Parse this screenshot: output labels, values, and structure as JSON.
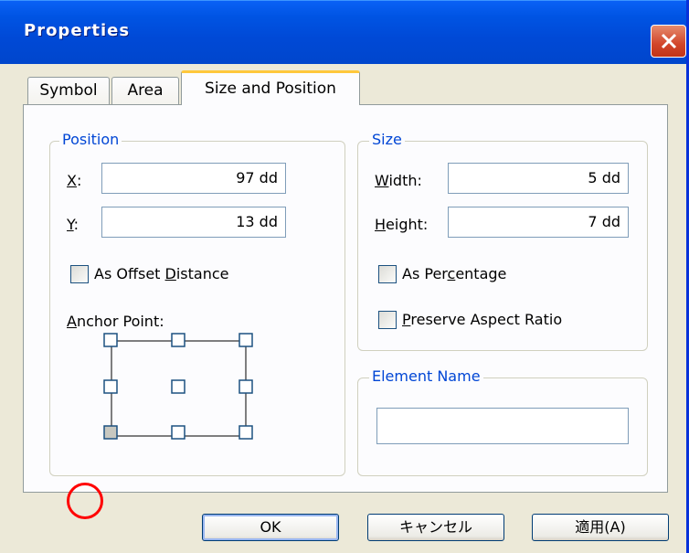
{
  "window": {
    "title": "Properties"
  },
  "tabs": [
    {
      "label": "Symbol"
    },
    {
      "label": "Area"
    },
    {
      "label": "Size and Position"
    }
  ],
  "position": {
    "group_label": "Position",
    "x_label_key": "X",
    "x_label_rest": ":",
    "x_value": "97 dd",
    "y_label_key": "Y",
    "y_label_rest": ":",
    "y_value": "13 dd",
    "offset_pre": "As Offset ",
    "offset_key": "D",
    "offset_post": "istance",
    "offset_checked": false,
    "anchor_key": "A",
    "anchor_rest": "nchor Point:",
    "anchor_selected": "bottom-left"
  },
  "size": {
    "group_label": "Size",
    "width_key": "W",
    "width_rest": "idth:",
    "width_value": "5 dd",
    "height_key": "H",
    "height_rest": "eight:",
    "height_value": "7 dd",
    "percentage_pre": "As Per",
    "percentage_key": "c",
    "percentage_post": "entage",
    "percentage_checked": false,
    "preserve_key": "P",
    "preserve_rest": "reserve Aspect Ratio",
    "preserve_checked": false
  },
  "element_name": {
    "group_label": "Element Name",
    "value": ""
  },
  "buttons": {
    "ok": "OK",
    "cancel": "キャンセル",
    "apply": "適用(A)"
  },
  "colors": {
    "titlebar": "#0054e3",
    "group_label": "#0046d5",
    "tab_highlight": "#ffc83c",
    "marker": "#ff0000"
  }
}
